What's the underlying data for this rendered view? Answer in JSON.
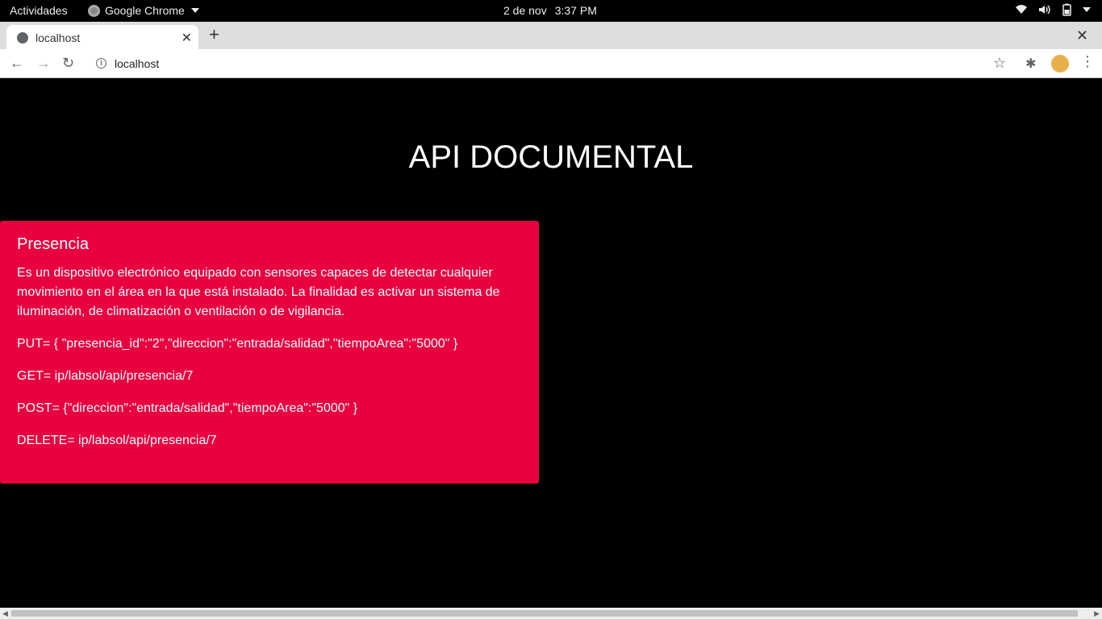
{
  "system": {
    "activities": "Actividades",
    "app_name": "Google Chrome",
    "date": "2 de nov",
    "time": "3:37 PM",
    "icons": [
      "wifi-icon",
      "volume-icon",
      "battery-icon",
      "chevron-down-icon"
    ]
  },
  "browser": {
    "tab_title": "localhost",
    "url": "localhost",
    "icons": {
      "back": "←",
      "forward": "→",
      "reload": "↻",
      "new_tab": "+",
      "close_tab": "✕",
      "close_window": "✕",
      "star": "☆",
      "extensions": "✱",
      "menu": "⋮"
    }
  },
  "page": {
    "heading": "API DOCUMENTAL",
    "card": {
      "title": "Presencia",
      "description": "Es un dispositivo electrónico equipado con sensores capaces de detectar cualquier movimiento en el área en la que está instalado. La finalidad es activar un sistema de iluminación, de climatización o ventilación o de vigilancia.",
      "put": "PUT= { \"presencia_id\":\"2\",\"direccion\":\"entrada/salidad\",\"tiempoArea\":\"5000\" }",
      "get": "GET= ip/labsol/api/presencia/7",
      "post": "POST= {\"direccion\":\"entrada/salidad\",\"tiempoArea\":\"5000\" }",
      "delete": "DELETE= ip/labsol/api/presencia/7",
      "color": "#e8003f"
    }
  }
}
